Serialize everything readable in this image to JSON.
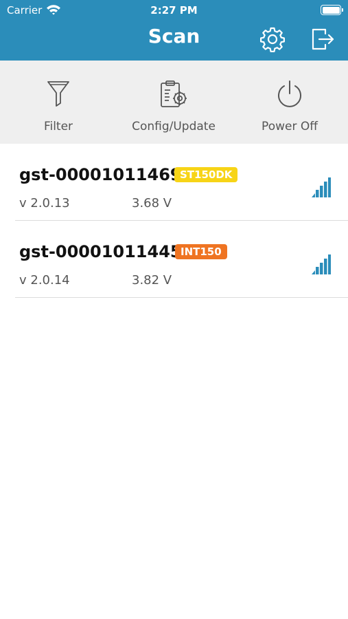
{
  "status_bar": {
    "carrier": "Carrier",
    "time": "2:27 PM",
    "wifi_icon": "wifi-icon",
    "battery_icon": "battery-full-icon"
  },
  "nav": {
    "title": "Scan",
    "settings_icon": "gear-icon",
    "exit_icon": "exit-icon"
  },
  "toolbar": {
    "filter_label": "Filter",
    "config_label": "Config/Update",
    "power_label": "Power Off"
  },
  "devices": [
    {
      "name": "gst-000010114692",
      "badge": "ST150DK",
      "badge_color": "#f7d417",
      "version": "v 2.0.13",
      "voltage": "3.68 V",
      "signal_icon": "signal-strength-icon"
    },
    {
      "name": "gst-000010114451",
      "badge": "INT150",
      "badge_color": "#ef7422",
      "version": "v 2.0.14",
      "voltage": "3.82 V",
      "signal_icon": "signal-strength-icon"
    }
  ],
  "colors": {
    "primary": "#2b8dba",
    "toolbar_bg": "#efefef",
    "signal": "#2b8dba"
  }
}
